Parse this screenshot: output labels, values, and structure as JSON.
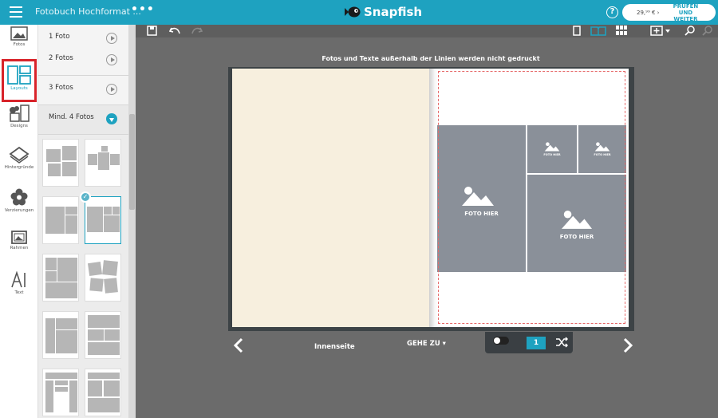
{
  "app": {
    "doc_title": "Fotobuch Hochformat ...",
    "more_menu": "•••",
    "brand": "Snapfish",
    "help": "?",
    "price": "29,⁹⁹ € ›",
    "checkout_line1": "PRÜFEN UND",
    "checkout_line2": "WEITER",
    "brand_color": "#1ea2c0"
  },
  "rail": {
    "items": [
      {
        "label": "Fotos",
        "icon": "photo-icon"
      },
      {
        "label": "Layouts",
        "icon": "layout-icon"
      },
      {
        "label": "Designs",
        "icon": "designs-icon"
      },
      {
        "label": "Hintergründe",
        "icon": "background-icon"
      },
      {
        "label": "Verzierungen",
        "icon": "flower-icon"
      },
      {
        "label": "Rahmen",
        "icon": "frame-icon"
      },
      {
        "label": "Text",
        "icon": "text-icon"
      }
    ],
    "active": "Layouts"
  },
  "panel": {
    "categories": [
      {
        "label": "1 Foto"
      },
      {
        "label": "2 Fotos"
      },
      {
        "label": "3 Fotos"
      },
      {
        "label": "Mind. 4 Fotos"
      }
    ],
    "open_category": "Mind. 4 Fotos",
    "selected_thumb": 4
  },
  "canvas": {
    "notice": "Fotos und Texte außerhalb der Linien werden nicht gedruckt",
    "photo_placeholder": "FOTO HIER",
    "page_label": "Innenseite",
    "goto": "GEHE ZU ▾",
    "page_number": "1"
  }
}
